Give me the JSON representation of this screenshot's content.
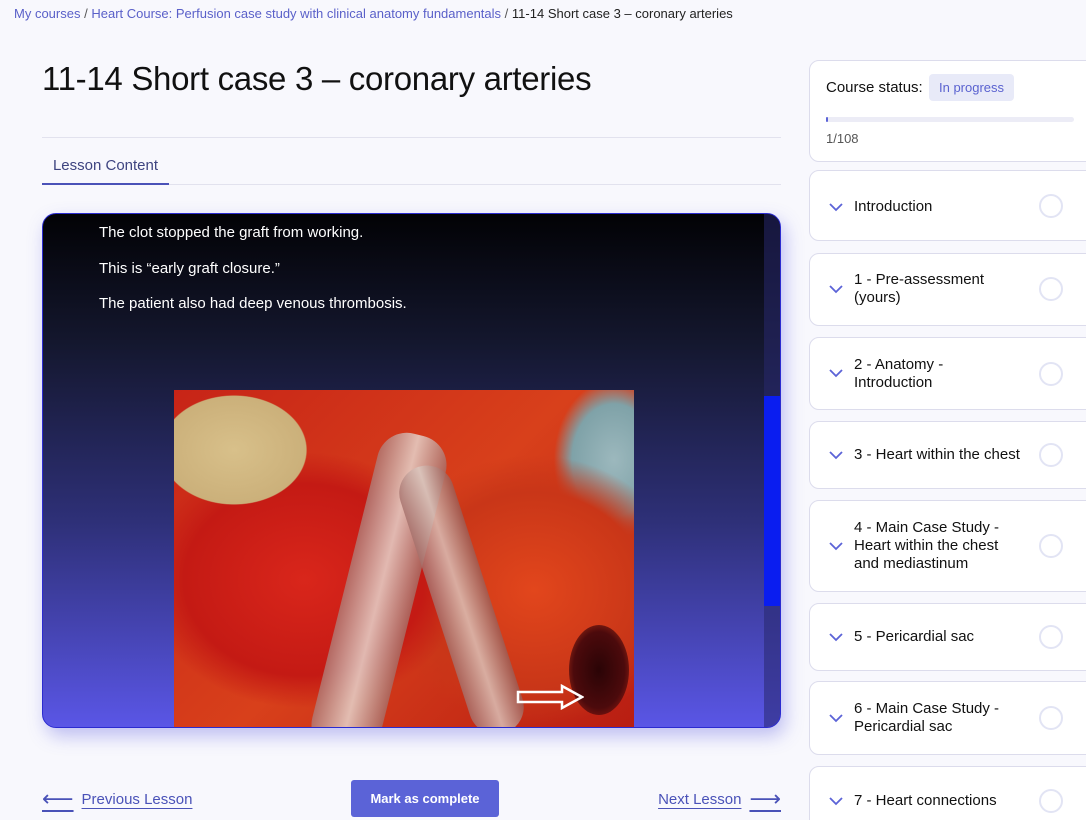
{
  "breadcrumb": {
    "item1": "My courses",
    "sep1": "/",
    "item2": "Heart Course: Perfusion case study with clinical anatomy fundamentals",
    "sep2": "/",
    "current": "11-14 Short case 3 – coronary arteries"
  },
  "page": {
    "title": "11-14 Short case 3 – coronary arteries",
    "tab": "Lesson Content"
  },
  "video": {
    "lines": [
      "The clot stopped the graft from working.",
      "This is “early graft closure.”",
      "The patient also had deep venous thrombosis."
    ]
  },
  "nav": {
    "prev": "Previous Lesson",
    "complete": "Mark as complete",
    "next": "Next Lesson"
  },
  "sidebar": {
    "status_label": "Course status:",
    "status_badge": "In progress",
    "progress_text": "1/108",
    "progress_fraction": 0.009,
    "modules": [
      "Introduction",
      "1 - Pre-assessment (yours)",
      "2 - Anatomy - Introduction",
      "3 - Heart within the chest",
      "4 - Main Case Study - Heart within the chest and mediastinum",
      "5 - Pericardial sac",
      "6 - Main Case Study - Pericardial sac",
      "7 - Heart connections"
    ]
  },
  "colors": {
    "accent": "#5b63d7",
    "link": "#5a60c9",
    "scroll_thumb": "#0a1df0"
  }
}
